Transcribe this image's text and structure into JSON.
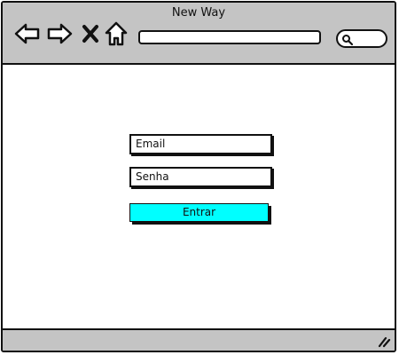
{
  "window": {
    "title": "New Way"
  },
  "toolbar": {
    "icons": [
      "back-arrow-icon",
      "forward-arrow-icon",
      "close-x-icon",
      "home-icon"
    ],
    "address_value": "",
    "search_icon": "magnifier-icon"
  },
  "login": {
    "email_placeholder": "Email",
    "password_placeholder": "Senha",
    "submit_label": "Entrar"
  },
  "colors": {
    "chrome": "#c4c4c4",
    "button": "#00ffff",
    "outline": "#111111"
  }
}
